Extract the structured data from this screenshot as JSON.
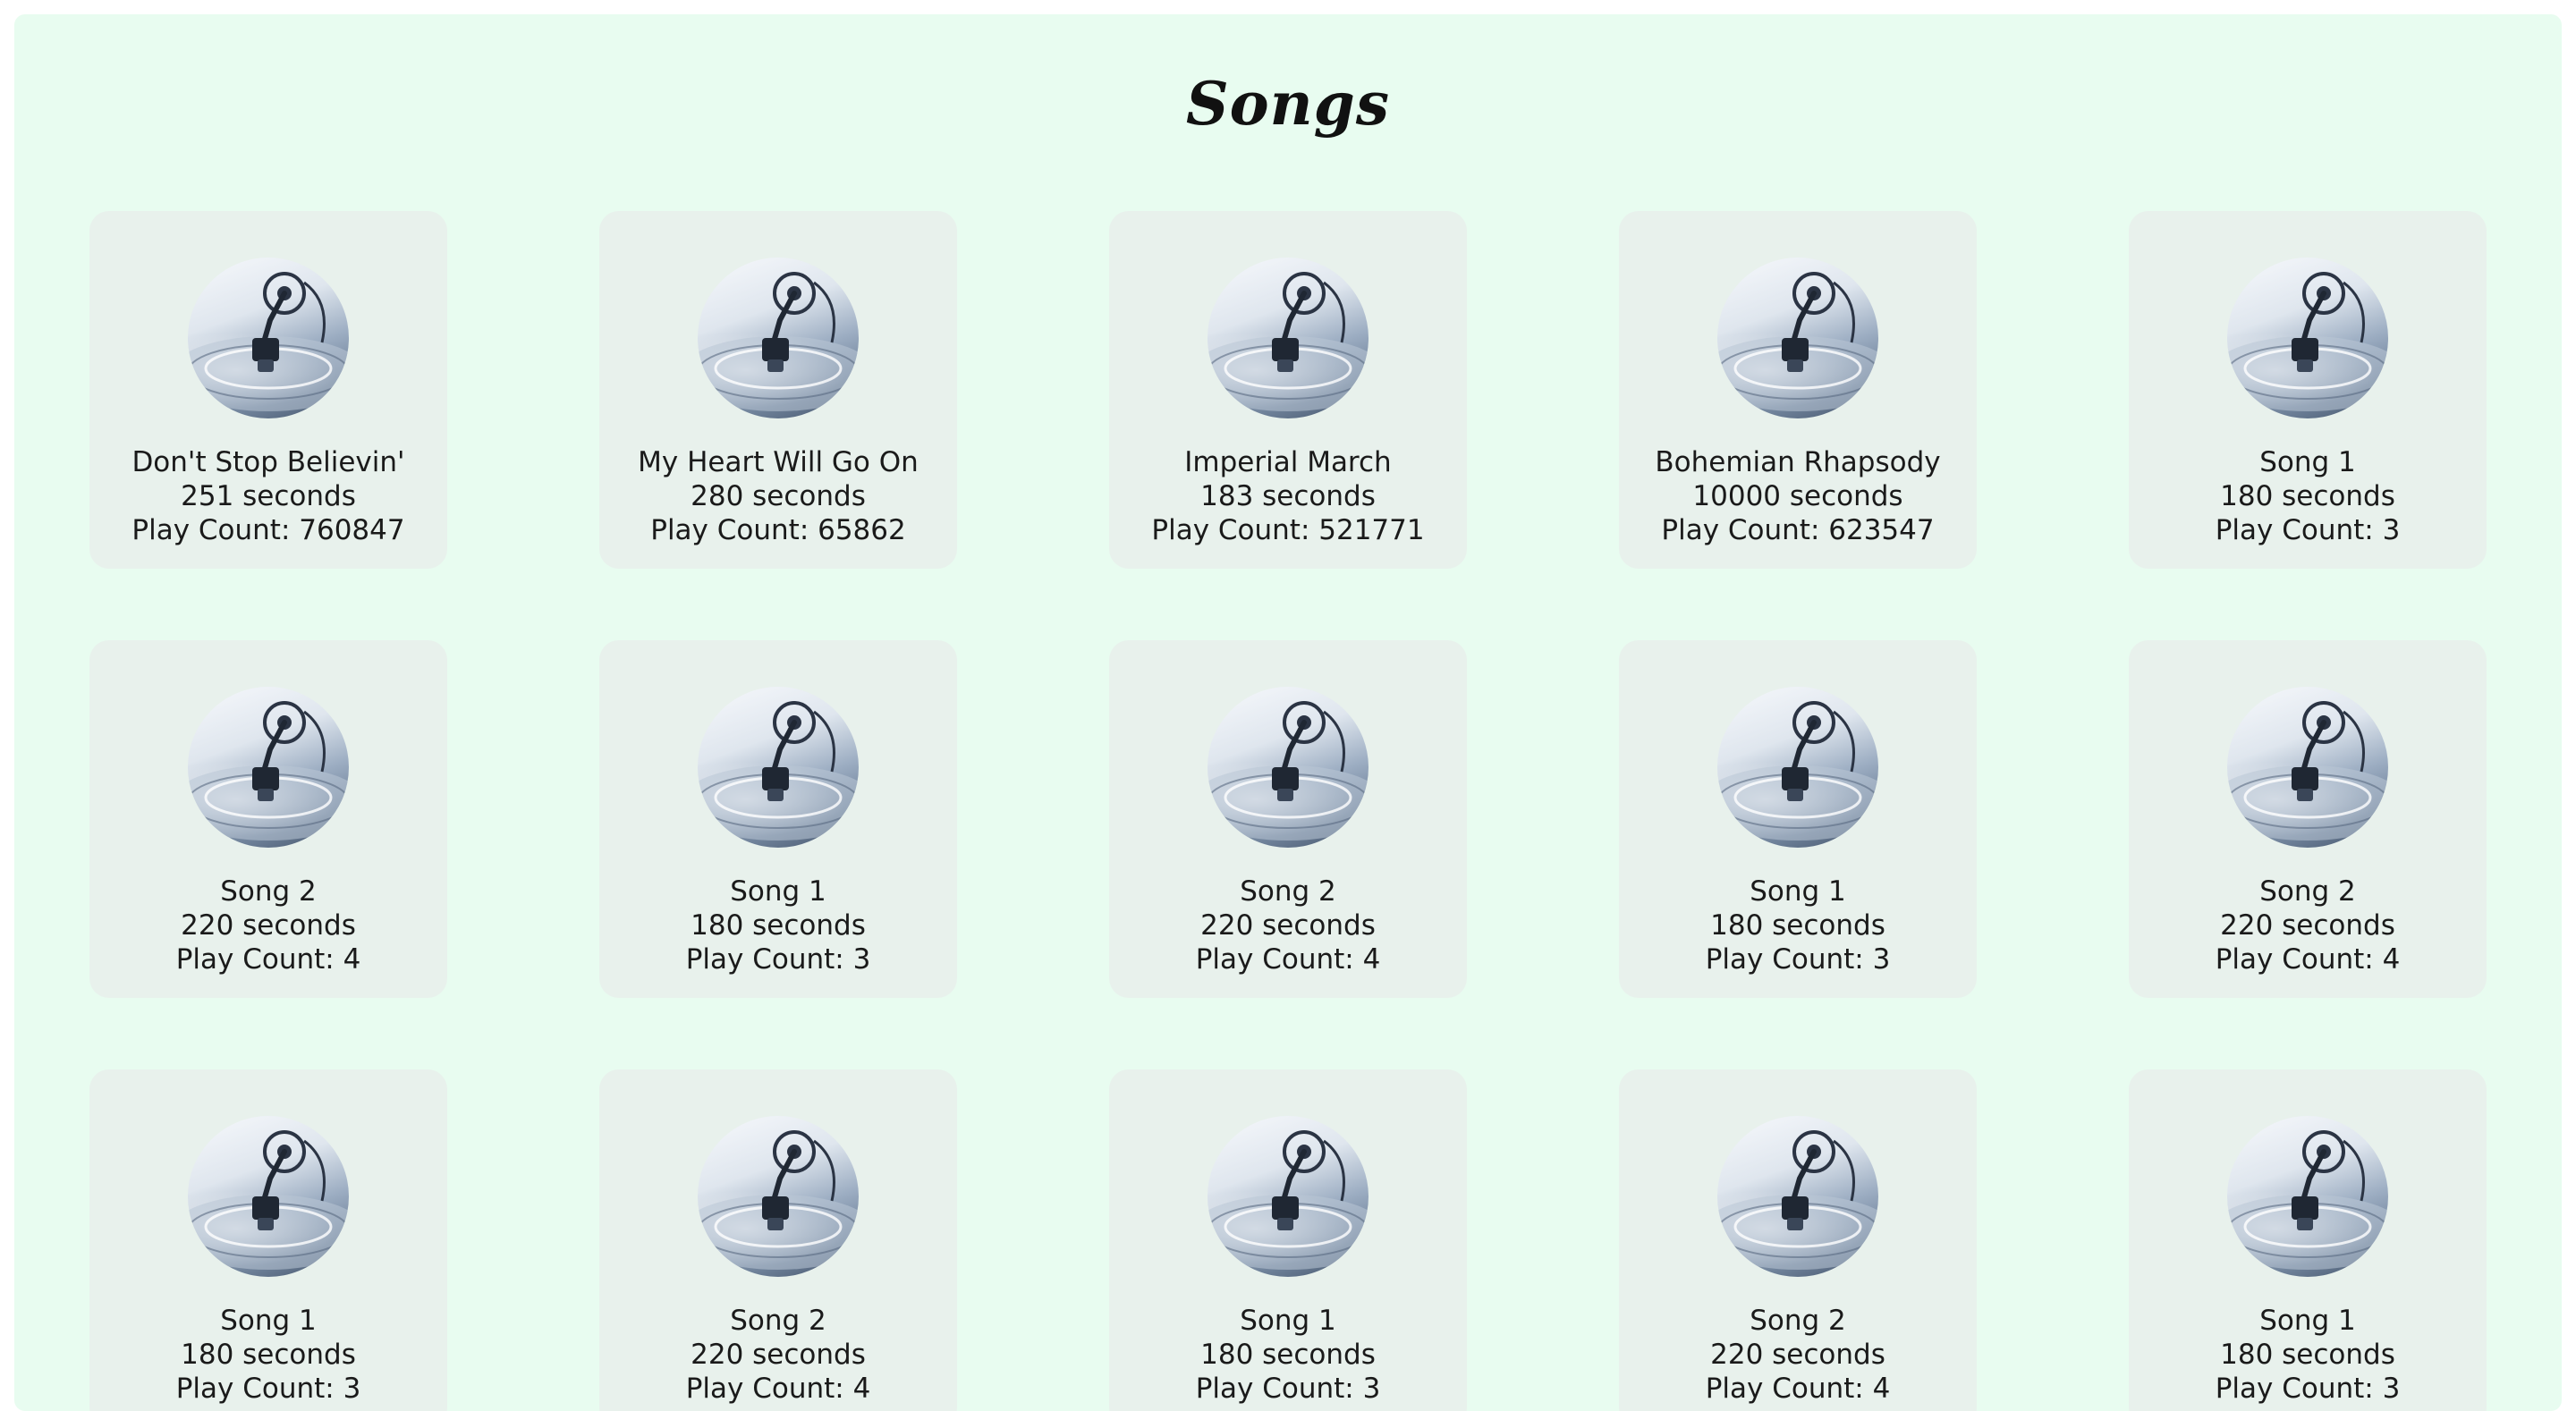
{
  "header": {
    "title": "Songs"
  },
  "icon": "turntable-album-art",
  "songs": [
    {
      "title": "Don't Stop Believin'",
      "duration": "251 seconds",
      "plays": "Play Count: 760847"
    },
    {
      "title": "My Heart Will Go On",
      "duration": "280 seconds",
      "plays": "Play Count: 65862"
    },
    {
      "title": "Imperial March",
      "duration": "183 seconds",
      "plays": "Play Count: 521771"
    },
    {
      "title": "Bohemian Rhapsody",
      "duration": "10000 seconds",
      "plays": "Play Count: 623547"
    },
    {
      "title": "Song 1",
      "duration": "180 seconds",
      "plays": "Play Count: 3"
    },
    {
      "title": "Song 2",
      "duration": "220 seconds",
      "plays": "Play Count: 4"
    },
    {
      "title": "Song 1",
      "duration": "180 seconds",
      "plays": "Play Count: 3"
    },
    {
      "title": "Song 2",
      "duration": "220 seconds",
      "plays": "Play Count: 4"
    },
    {
      "title": "Song 1",
      "duration": "180 seconds",
      "plays": "Play Count: 3"
    },
    {
      "title": "Song 2",
      "duration": "220 seconds",
      "plays": "Play Count: 4"
    },
    {
      "title": "Song 1",
      "duration": "180 seconds",
      "plays": "Play Count: 3"
    },
    {
      "title": "Song 2",
      "duration": "220 seconds",
      "plays": "Play Count: 4"
    },
    {
      "title": "Song 1",
      "duration": "180 seconds",
      "plays": "Play Count: 3"
    },
    {
      "title": "Song 2",
      "duration": "220 seconds",
      "plays": "Play Count: 4"
    },
    {
      "title": "Song 1",
      "duration": "180 seconds",
      "plays": "Play Count: 3"
    }
  ]
}
